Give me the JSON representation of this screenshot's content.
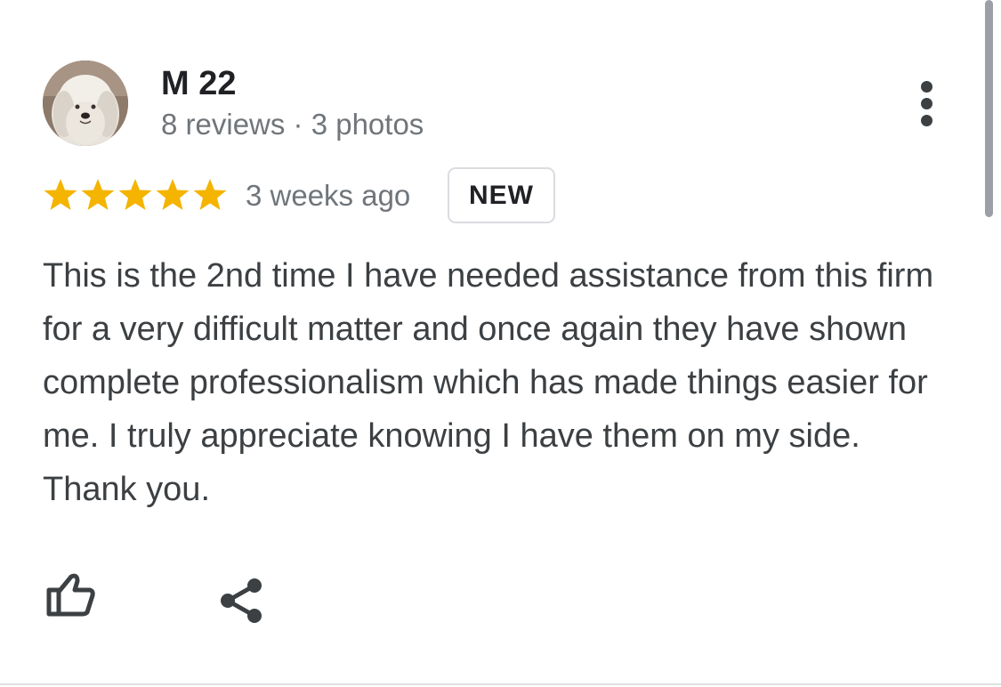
{
  "reviewer": {
    "name": "M 22",
    "meta": "8 reviews · 3 photos",
    "avatar_icon": "dog-avatar"
  },
  "review": {
    "rating": 5,
    "max_rating": 5,
    "date": "3 weeks ago",
    "badge": "NEW",
    "text": "This is the 2nd time I have needed assistance from this firm for a very difficult matter and once again they have shown complete professionalism which has made things easier for me. I truly appreciate knowing I have them on my side. Thank you."
  },
  "actions": {
    "more_icon": "more-vert-icon",
    "like_icon": "thumbs-up-icon",
    "share_icon": "share-icon"
  },
  "colors": {
    "star": "#f4b400",
    "text_primary": "#202124",
    "text_secondary": "#70757a",
    "text_body": "#3c4043"
  }
}
